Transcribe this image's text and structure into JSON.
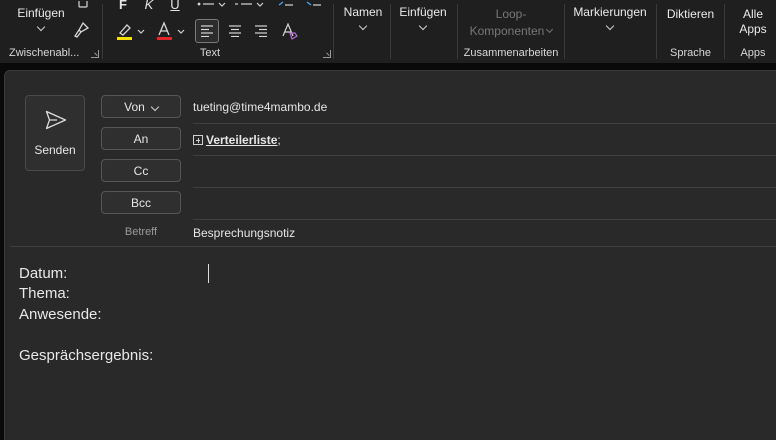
{
  "ribbon": {
    "clipboard": {
      "paste_label": "Einfügen",
      "group_label": "Zwischenabl..."
    },
    "text": {
      "bold": "F",
      "italic": "K",
      "underline": "U",
      "group_label": "Text",
      "highlight_color": "#f5e000",
      "font_color": "#e0262b"
    },
    "names": {
      "label": "Namen"
    },
    "insert": {
      "label": "Einfügen"
    },
    "collaborate": {
      "loop_label_1": "Loop-",
      "loop_label_2": "Komponenten",
      "group_label": "Zusammenarbeiten"
    },
    "tags": {
      "label": "Markierungen"
    },
    "speech": {
      "label": "Diktieren",
      "group_label": "Sprache"
    },
    "apps": {
      "label_1": "Alle",
      "label_2": "Apps",
      "group_label": "Apps"
    }
  },
  "compose": {
    "send_label": "Senden",
    "from": {
      "button_label": "Von",
      "value": "tueting@time4mambo.de"
    },
    "to": {
      "button_label": "An",
      "value": "Verteilerliste",
      "suffix": ";"
    },
    "cc": {
      "button_label": "Cc",
      "value": ""
    },
    "bcc": {
      "button_label": "Bcc",
      "value": ""
    },
    "subject": {
      "label": "Betreff",
      "value": "Besprechungsnotiz"
    },
    "body": {
      "line1": "Datum:",
      "line2": "Thema:",
      "line3": "Anwesende:",
      "line4": "Gesprächsergebnis:"
    }
  }
}
